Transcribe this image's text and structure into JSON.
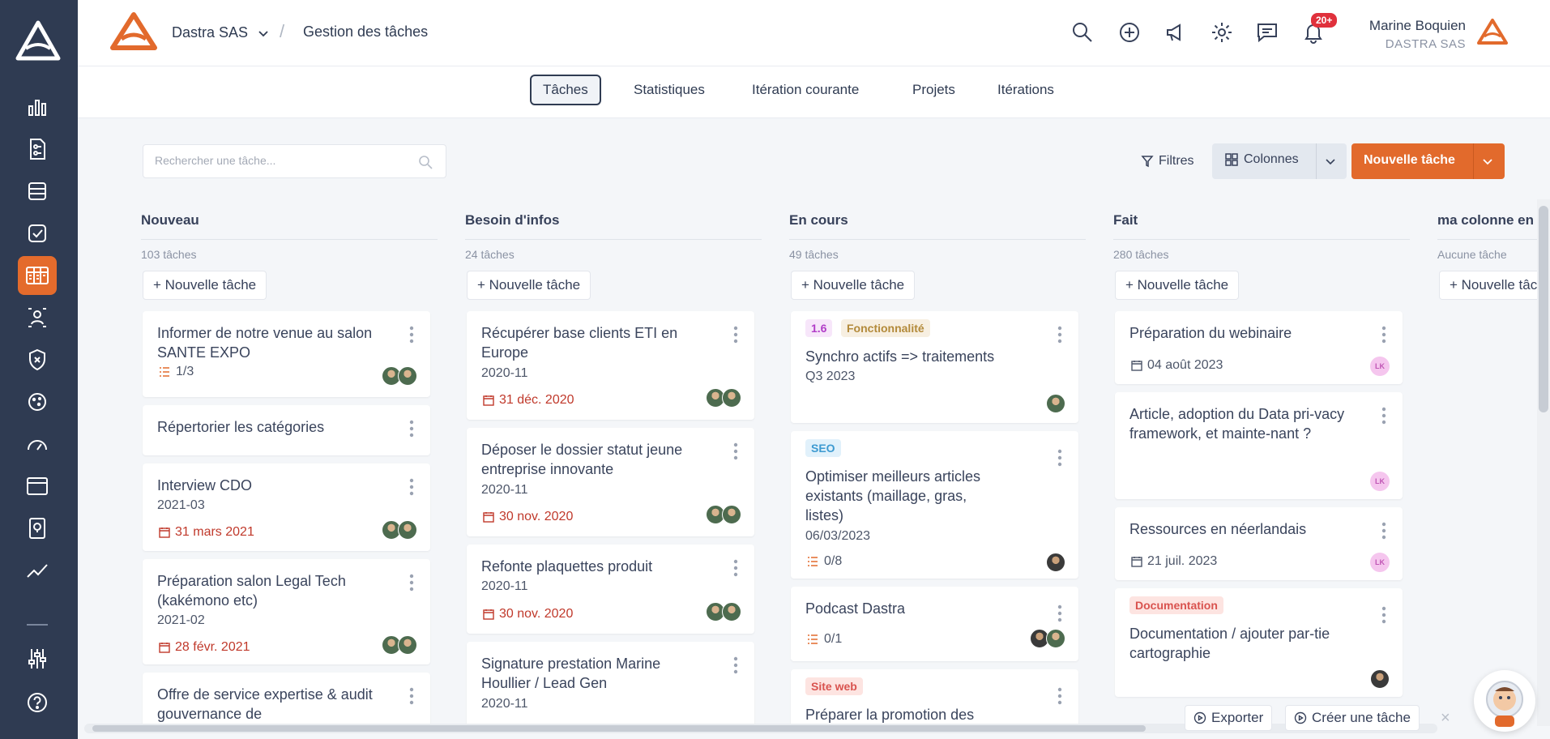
{
  "header": {
    "company": "Dastra SAS",
    "separator": "/",
    "page_title": "Gestion des tâches",
    "notif_badge": "20+",
    "user_name": "Marine Boquien",
    "user_company": "DASTRA SAS"
  },
  "tabs": [
    "Tâches",
    "Statistiques",
    "Itération courante",
    "Projets",
    "Itérations"
  ],
  "toolbar": {
    "search_placeholder": "Rechercher une tâche...",
    "filters": "Filtres",
    "columns": "Colonnes",
    "new_task": "Nouvelle tâche"
  },
  "add_task_label": "+ Nouvelle tâche",
  "columns": [
    {
      "title": "Nouveau",
      "count": "103 tâches",
      "cards": [
        {
          "title": "Informer de notre venue au salon SANTE EXPO",
          "progress": "1/3"
        },
        {
          "title": "Répertorier les catégories"
        },
        {
          "title": "Interview CDO",
          "sub": "2021-03",
          "date": "31 mars 2021"
        },
        {
          "title": "Préparation salon Legal Tech (kakémono etc)",
          "sub": "2021-02",
          "date": "28 févr. 2021"
        },
        {
          "title": "Offre de service expertise & audit gouvernance de"
        }
      ]
    },
    {
      "title": "Besoin d'infos",
      "count": "24 tâches",
      "cards": [
        {
          "title": "Récupérer base clients ETI en Europe",
          "sub": "2020-11",
          "date": "31 déc. 2020"
        },
        {
          "title": "Déposer le dossier statut jeune entreprise innovante",
          "sub": "2020-11",
          "date": "30 nov. 2020"
        },
        {
          "title": "Refonte plaquettes produit",
          "sub": "2020-11",
          "date": "30 nov. 2020"
        },
        {
          "title": "Signature prestation Marine Houllier / Lead Gen",
          "sub": "2020-11"
        }
      ]
    },
    {
      "title": "En cours",
      "count": "49 tâches",
      "cards": [
        {
          "tags": [
            "1.6",
            "Fonctionnalité"
          ],
          "title": "Synchro actifs => traitements",
          "sub": "Q3 2023"
        },
        {
          "tags": [
            "SEO"
          ],
          "title": "Optimiser meilleurs articles existants (maillage, gras, listes)",
          "sub": "06/03/2023",
          "progress": "0/8"
        },
        {
          "title": "Podcast Dastra",
          "progress": "0/1"
        },
        {
          "tags": [
            "Site web"
          ],
          "title": "Préparer la promotion des"
        }
      ]
    },
    {
      "title": "Fait",
      "count": "280 tâches",
      "cards": [
        {
          "title": "Préparation du webinaire",
          "date": "04 août 2023",
          "avatar": "LK"
        },
        {
          "title": "Article, adoption du Data pri-vacy framework, et mainte-nant ?",
          "avatar": "LK"
        },
        {
          "title": "Ressources en néerlandais",
          "date": "21 juil. 2023",
          "avatar": "LK"
        },
        {
          "tags": [
            "Documentation"
          ],
          "title": "Documentation / ajouter par-tie cartographie"
        }
      ]
    },
    {
      "title": "ma colonne en",
      "count": "Aucune tâche",
      "cards": []
    }
  ],
  "footer": {
    "export": "Exporter",
    "create": "Créer une tâche",
    "close": "×"
  },
  "colors": {
    "sidebar": "#2f3b52",
    "accent": "#e26a2c",
    "overdue": "#c0392b"
  }
}
